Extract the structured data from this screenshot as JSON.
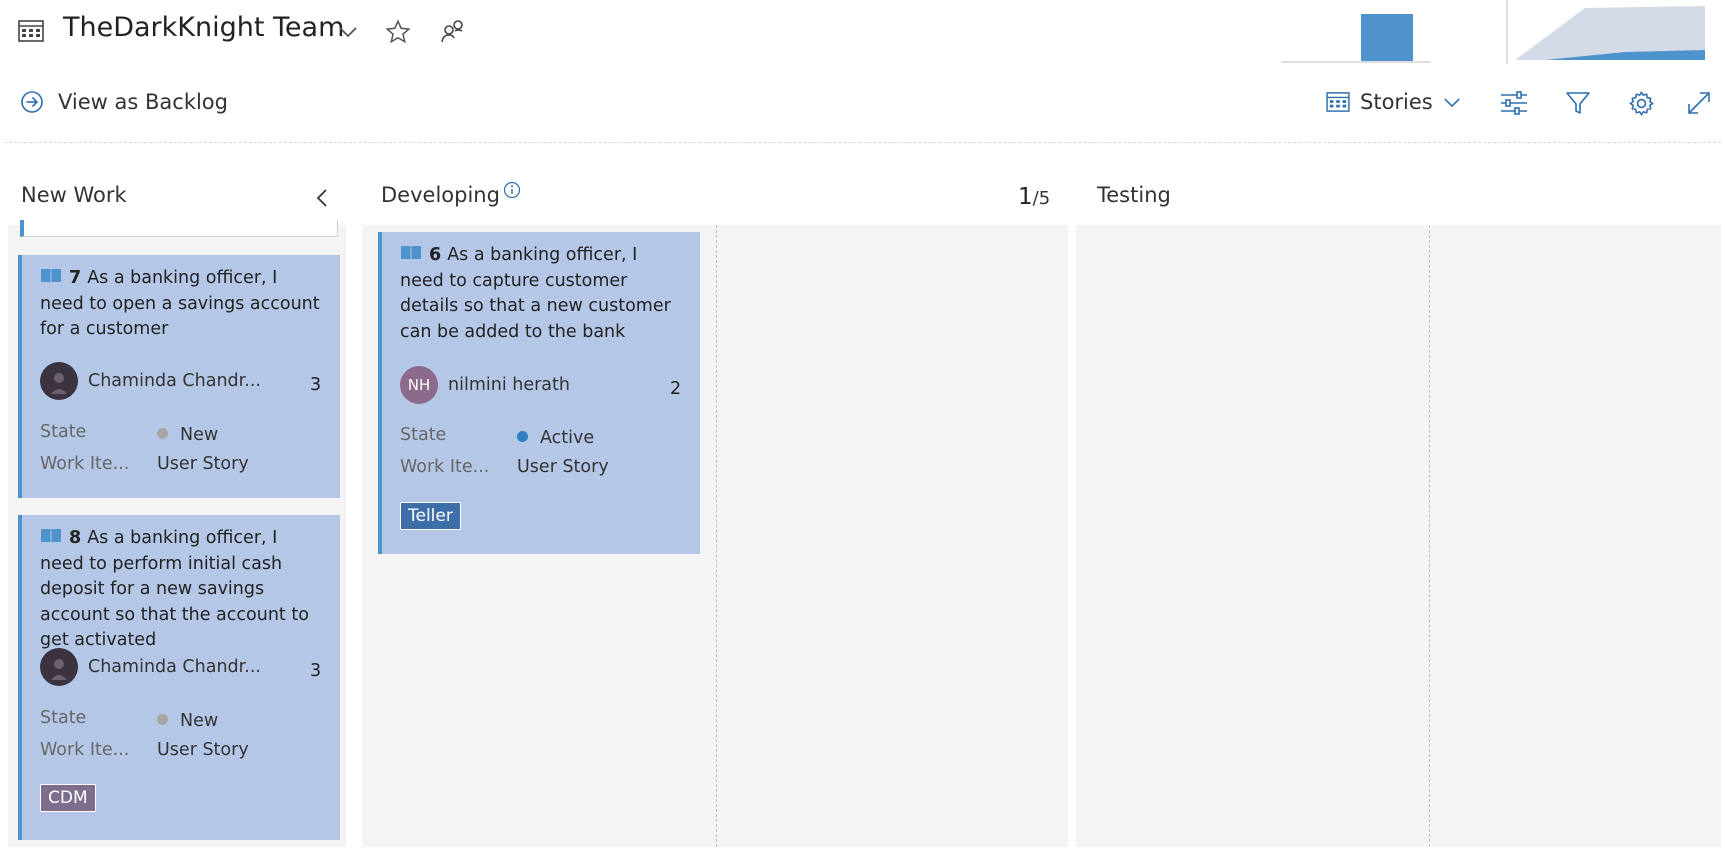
{
  "header": {
    "team_name": "TheDarkKnight Team",
    "board_icon": "board-icon",
    "favorite_icon": "star-icon",
    "team_members_icon": "people-icon"
  },
  "toolbar": {
    "view_as_backlog": "View as Backlog",
    "backlog_level": "Stories",
    "icons": [
      "settings-sliders-icon",
      "filter-icon",
      "gear-icon",
      "fullscreen-icon"
    ]
  },
  "columns": {
    "new_work": {
      "title": "New Work"
    },
    "developing": {
      "title": "Developing",
      "wip_current": "1",
      "wip_limit": "/5"
    },
    "testing": {
      "title": "Testing"
    }
  },
  "cards": [
    {
      "id": "7",
      "title": "As a banking officer, I need to open a savings account for a customer",
      "assignee": "Chaminda Chandr...",
      "points": "3",
      "state_label": "State",
      "state": "New",
      "type_label": "Work Ite...",
      "type": "User Story"
    },
    {
      "id": "8",
      "title": "As a banking officer, I need to perform initial cash deposit for a new savings account so that the account to get activated",
      "assignee": "Chaminda Chandr...",
      "points": "3",
      "state_label": "State",
      "state": "New",
      "type_label": "Work Ite...",
      "type": "User Story",
      "tag": "CDM"
    },
    {
      "id": "6",
      "title": "As a banking officer, I need to capture customer details so that a new customer can be added to the bank",
      "assignee": "nilmini herath",
      "assignee_initials": "NH",
      "points": "2",
      "state_label": "State",
      "state": "Active",
      "type_label": "Work Ite...",
      "type": "User Story",
      "tag": "Teller"
    }
  ],
  "colors": {
    "card_bg": "#b4c7e7",
    "card_border": "#4f93cc",
    "state_new": "#a6a6a6",
    "state_active": "#2f7fc1",
    "tag_cdm": "#7d6e8e",
    "tag_teller": "#3d6ea8"
  }
}
